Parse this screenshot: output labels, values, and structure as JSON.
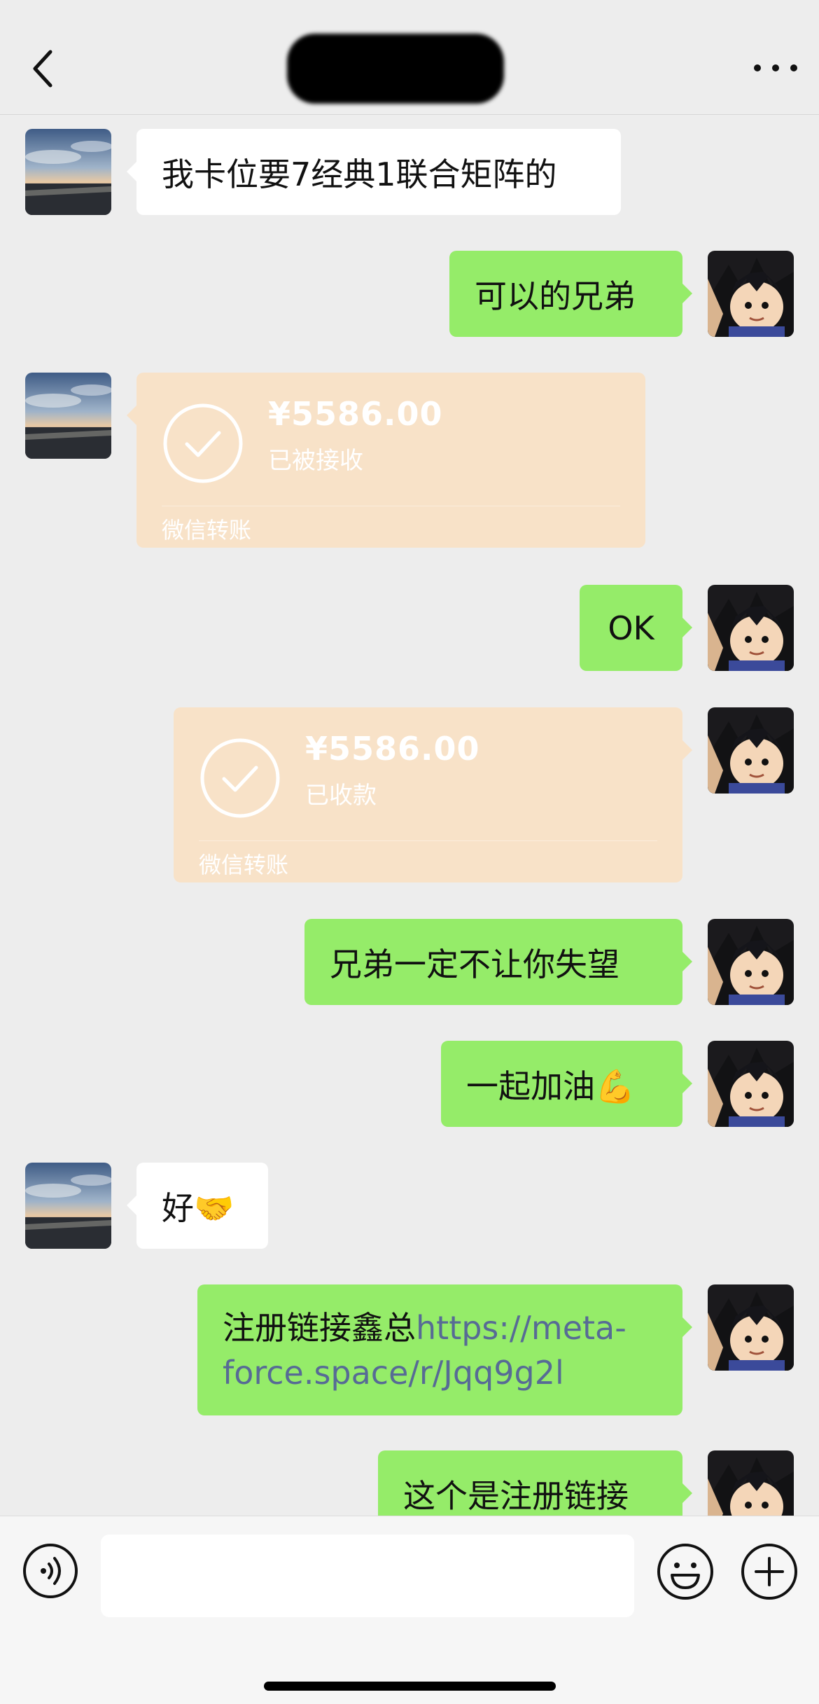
{
  "header": {
    "back_icon": "chevron-left-icon",
    "more_icon": "more-dots-icon"
  },
  "messages": [
    {
      "side": "left",
      "text": "我卡位要7经典1联合矩阵的"
    },
    {
      "side": "right",
      "text": "可以的兄弟"
    },
    {
      "side": "left",
      "type": "transfer",
      "amount": "¥5586.00",
      "status": "已被接收",
      "footer": "微信转账"
    },
    {
      "side": "right",
      "text": "OK"
    },
    {
      "side": "right",
      "type": "transfer",
      "amount": "¥5586.00",
      "status": "已收款",
      "footer": "微信转账"
    },
    {
      "side": "right",
      "text": "兄弟一定不让你失望"
    },
    {
      "side": "right",
      "text": "一起加油💪"
    },
    {
      "side": "left",
      "text": "好🤝"
    },
    {
      "side": "right",
      "text_prefix": "注册链接鑫总",
      "link": "https://meta-force.space/r/Jqq9g2l"
    },
    {
      "side": "right",
      "text": "这个是注册链接"
    }
  ],
  "input": {
    "placeholder": ""
  },
  "colors": {
    "bg": "#ededed",
    "green_bubble": "#95ec69",
    "white_bubble": "#ffffff",
    "transfer_bg": "#f8e2c8",
    "link": "#576b95"
  }
}
